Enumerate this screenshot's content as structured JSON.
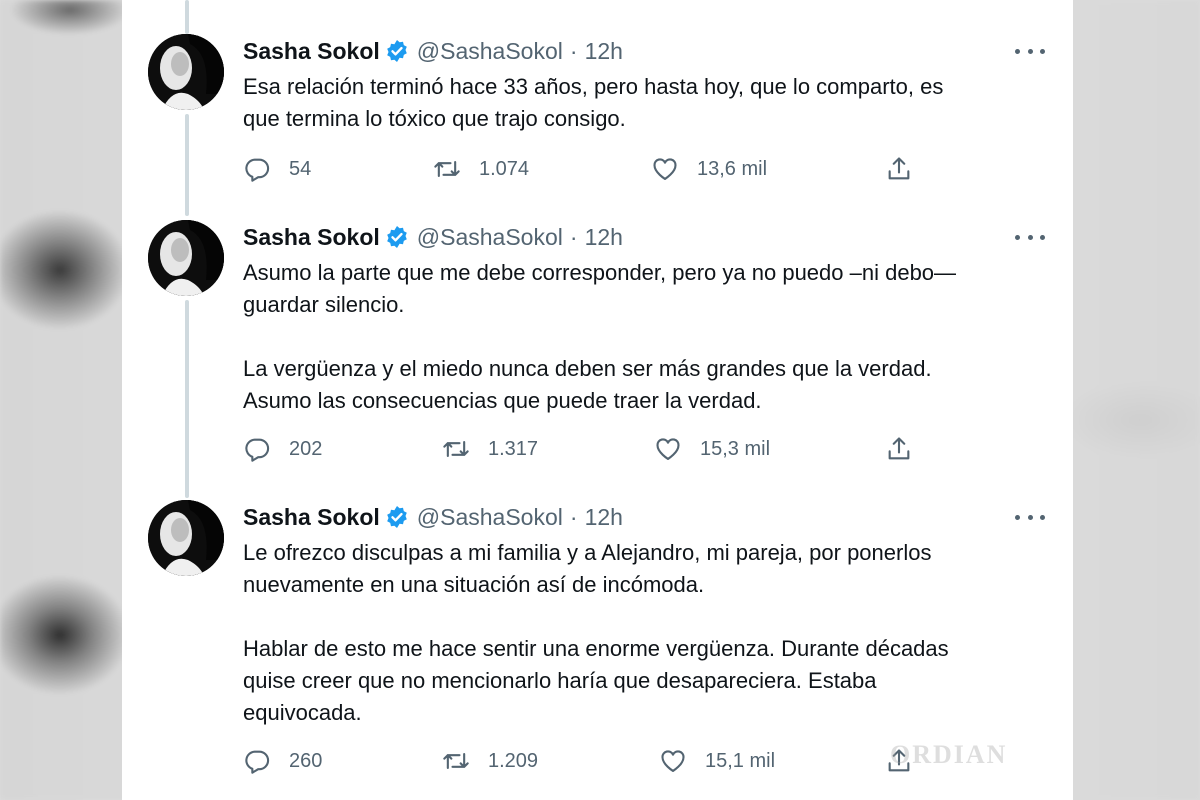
{
  "watermark": "ORDIAN",
  "tweets": [
    {
      "author": {
        "name": "Sasha Sokol",
        "handle": "@SashaSokol",
        "time": "12h",
        "separator": "·",
        "verified": true
      },
      "text": "Esa relación terminó hace 33 años, pero hasta hoy, que lo comparto, es\nque termina lo tóxico que trajo consigo.",
      "actions": {
        "replies": "54",
        "retweets": "1.074",
        "likes": "13,6 mil"
      }
    },
    {
      "author": {
        "name": "Sasha Sokol",
        "handle": "@SashaSokol",
        "time": "12h",
        "separator": "·",
        "verified": true
      },
      "text": "Asumo la parte que me debe corresponder, pero ya no puedo –ni debo—\nguardar silencio.\n\nLa vergüenza y el miedo nunca deben ser más grandes que la verdad.\nAsumo las consecuencias que puede traer la verdad.",
      "actions": {
        "replies": "202",
        "retweets": "1.317",
        "likes": "15,3 mil"
      }
    },
    {
      "author": {
        "name": "Sasha Sokol",
        "handle": "@SashaSokol",
        "time": "12h",
        "separator": "·",
        "verified": true
      },
      "text": "Le ofrezco disculpas a mi familia y a Alejandro, mi pareja, por ponerlos\nnuevamente en una situación así de incómoda.\n\nHablar de esto me hace sentir una enorme vergüenza. Durante décadas\nquise creer que no mencionarlo haría que desapareciera. Estaba\nequivocada.",
      "actions": {
        "replies": "260",
        "retweets": "1.209",
        "likes": "15,1 mil"
      }
    }
  ],
  "icons": {
    "reply": "reply-icon",
    "retweet": "retweet-icon",
    "like": "heart-icon",
    "share": "share-icon",
    "more": "more-icon",
    "verified": "verified-badge-icon"
  },
  "colors": {
    "accent": "#1d9bf0",
    "muted": "#536471",
    "text": "#0f1419",
    "thread_line": "#cfd9de"
  }
}
